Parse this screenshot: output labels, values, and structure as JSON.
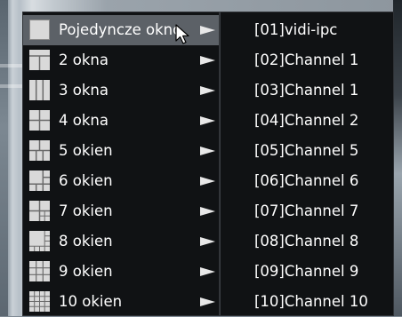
{
  "layout_menu": {
    "items": [
      {
        "label": "Pojedyncze okno",
        "icon": "single-window-layout-icon"
      },
      {
        "label": "2 okna",
        "icon": "two-window-layout-icon"
      },
      {
        "label": "3 okna",
        "icon": "three-window-layout-icon"
      },
      {
        "label": "4 okna",
        "icon": "four-window-layout-icon"
      },
      {
        "label": "5 okien",
        "icon": "five-window-layout-icon"
      },
      {
        "label": "6 okien",
        "icon": "six-window-layout-icon"
      },
      {
        "label": "7 okien",
        "icon": "seven-window-layout-icon"
      },
      {
        "label": "8 okien",
        "icon": "eight-window-layout-icon"
      },
      {
        "label": "9 okien",
        "icon": "nine-window-layout-icon"
      },
      {
        "label": "10 okien",
        "icon": "ten-window-layout-icon"
      }
    ],
    "highlighted_index": 0
  },
  "channel_submenu": {
    "items": [
      {
        "label": "[01]vidi-ipc"
      },
      {
        "label": "[02]Channel 1"
      },
      {
        "label": "[03]Channel 1"
      },
      {
        "label": "[04]Channel 2"
      },
      {
        "label": "[05]Channel 5"
      },
      {
        "label": "[06]Channel 6"
      },
      {
        "label": "[07]Channel 7"
      },
      {
        "label": "[08]Channel 8"
      },
      {
        "label": "[09]Channel 9"
      },
      {
        "label": "[10]Channel 10"
      }
    ]
  },
  "colors": {
    "menu_bg": "#101214",
    "highlight_bg": "#5c6167",
    "text": "#ffffff",
    "icon_light": "#d9d9d9",
    "icon_line": "#6a6a6a"
  }
}
